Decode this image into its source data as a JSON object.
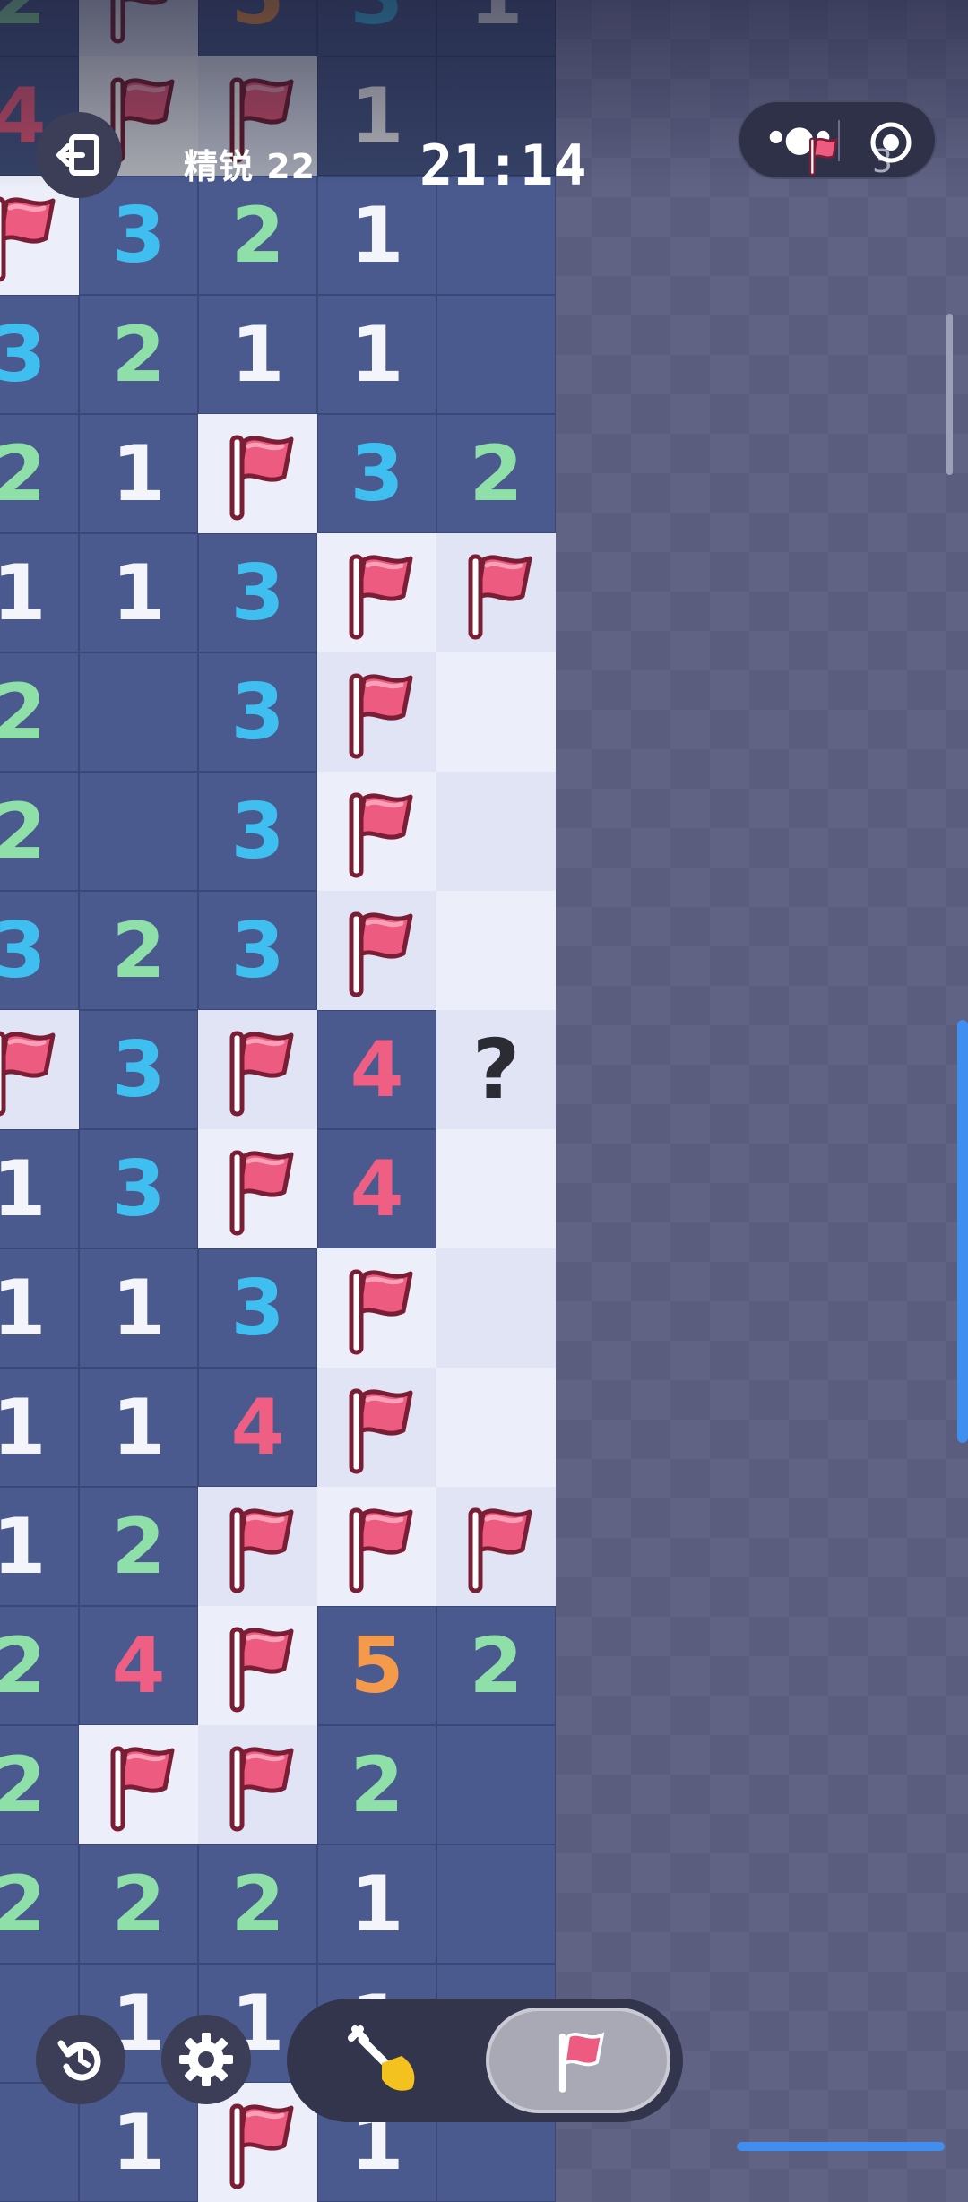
{
  "header": {
    "level_label": "精锐 22",
    "timer": "21:14",
    "flag_count": "3"
  },
  "icons": {
    "exit": "exit-icon",
    "menu": "more-dots-icon",
    "capsule_close": "target-icon",
    "restart": "restart-icon",
    "settings": "gear-icon",
    "dig": "shovel-icon",
    "flag": "flag-icon"
  },
  "controls": {
    "active_mode": "flag"
  },
  "board": {
    "rows": [
      [
        "2",
        "F",
        "5",
        "3",
        "1"
      ],
      [
        "4",
        "F",
        "F",
        "1",
        "O"
      ],
      [
        "F",
        "3",
        "2",
        "1",
        "O"
      ],
      [
        "3",
        "2",
        "1",
        "1",
        "O"
      ],
      [
        "2",
        "1",
        "F",
        "3",
        "2"
      ],
      [
        "1",
        "1",
        "3",
        "F",
        "F"
      ],
      [
        "2",
        "O",
        "3",
        "F",
        "C"
      ],
      [
        "2",
        "O",
        "3",
        "F",
        "C"
      ],
      [
        "3",
        "2",
        "3",
        "F",
        "C"
      ],
      [
        "F",
        "3",
        "F",
        "4",
        "?"
      ],
      [
        "1",
        "3",
        "F",
        "4",
        "C"
      ],
      [
        "1",
        "1",
        "3",
        "F",
        "C"
      ],
      [
        "1",
        "1",
        "4",
        "F",
        "C"
      ],
      [
        "1",
        "2",
        "F",
        "F",
        "F"
      ],
      [
        "2",
        "4",
        "F",
        "5",
        "2"
      ],
      [
        "2",
        "F",
        "F",
        "2",
        "O"
      ],
      [
        "2",
        "2",
        "2",
        "1",
        "O"
      ],
      [
        "O",
        "1",
        "1",
        "1",
        "O"
      ],
      [
        "O",
        "1",
        "F",
        "1",
        "O"
      ]
    ]
  },
  "colors": {
    "open_cell": "#4a5a8e",
    "closed_cell": "#eceff9",
    "number_1": "#f4f5fb",
    "number_2": "#8ee0a8",
    "number_3": "#3fbff0",
    "number_4": "#ef5f84",
    "number_5": "#f59a4a",
    "flag": "#ee5b80",
    "accent_scroll": "#3f8ef0"
  }
}
